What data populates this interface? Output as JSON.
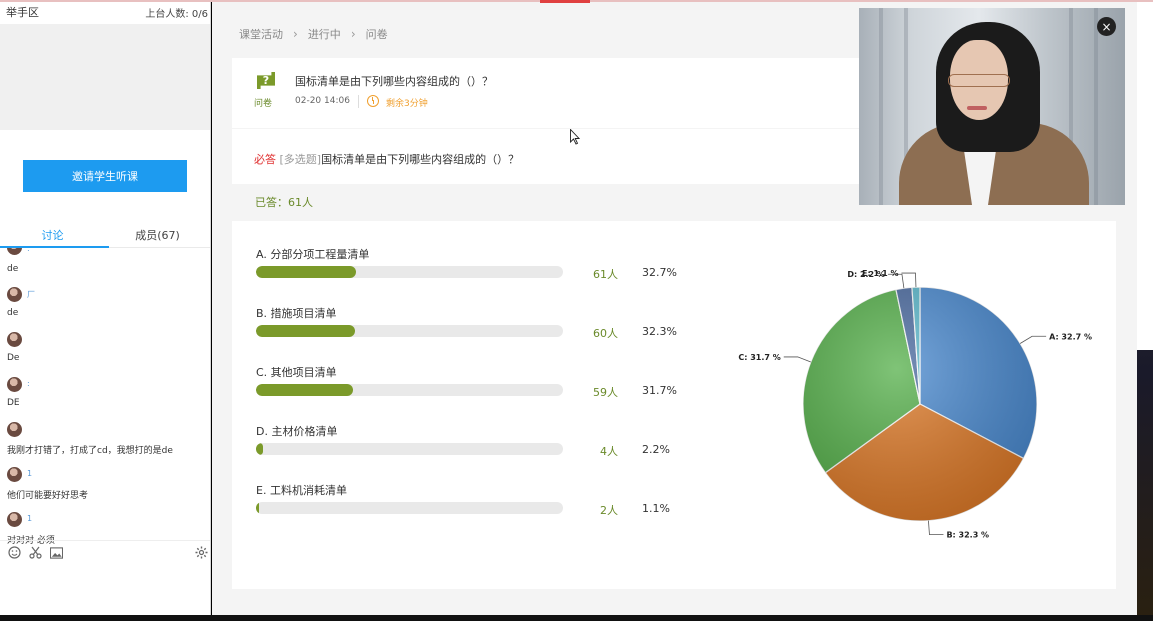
{
  "left_panel": {
    "raise_hand_title": "举手区",
    "stage_count": "上台人数: 0/6",
    "invite_button": "邀请学生听课",
    "tabs": [
      {
        "label": "讨论",
        "active": true
      },
      {
        "label": "成员(67)",
        "active": false
      }
    ],
    "messages": [
      {
        "name": ":",
        "text": "de"
      },
      {
        "name": "厂",
        "text": "de"
      },
      {
        "name": "",
        "text": "De"
      },
      {
        "name": ":",
        "text": "DE"
      },
      {
        "name": "",
        "text": "我刚才打错了，打成了cd，我想打的是de"
      },
      {
        "name": "1",
        "text": "他们可能要好好思考"
      },
      {
        "name": "1",
        "text": "对对对 必须"
      }
    ],
    "tools": [
      "emoji-icon",
      "scissors-icon",
      "image-icon",
      "gear-icon"
    ]
  },
  "breadcrumb": [
    "课堂活动",
    "进行中",
    "问卷"
  ],
  "question": {
    "icon": "?",
    "title": "国标清单是由下列哪些内容组成的（）？",
    "type_label": "问卷",
    "time": "02-20 14:06",
    "remaining": "剩余3分钟",
    "required": "必答",
    "multi": "[多选题]",
    "full_text": "国标清单是由下列哪些内容组成的（）？"
  },
  "answered": "已答：61人",
  "options": [
    {
      "label": "A. 分部分项工程量清单",
      "count": "61人",
      "percent": "32.7%",
      "fill": 32.7
    },
    {
      "label": "B. 措施项目清单",
      "count": "60人",
      "percent": "32.3%",
      "fill": 32.3
    },
    {
      "label": "C. 其他项目清单",
      "count": "59人",
      "percent": "31.7%",
      "fill": 31.7
    },
    {
      "label": "D. 主材价格清单",
      "count": "4人",
      "percent": "2.2%",
      "fill": 2.2
    },
    {
      "label": "E. 工料机消耗清单",
      "count": "2人",
      "percent": "1.1%",
      "fill": 1.1
    }
  ],
  "chart_data": {
    "type": "pie",
    "categories": [
      "A",
      "B",
      "C",
      "D",
      "E"
    ],
    "values": [
      32.7,
      32.3,
      31.7,
      2.2,
      1.1
    ],
    "labels": [
      "A: 32.7 %",
      "B: 32.3 %",
      "C: 31.7 %",
      "D: 2.2 %",
      "E: 1.1 %"
    ],
    "colors": [
      "#4a8ad0",
      "#de7a28",
      "#55b04a",
      "#4a6aa0",
      "#5ab8cc"
    ]
  },
  "video": {
    "close": "×"
  }
}
